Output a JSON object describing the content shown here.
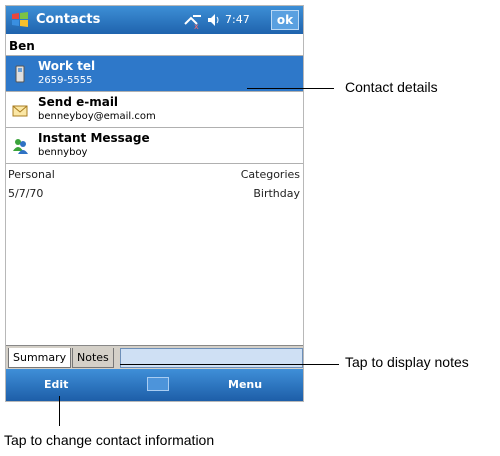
{
  "device": {
    "title": "Contacts",
    "time": "7:47",
    "ok_label": "ok",
    "icons": {
      "start": "windows-flag-icon",
      "connectivity": "connectivity-icon",
      "volume": "speaker-icon"
    }
  },
  "contact": {
    "name": "Ben",
    "items": [
      {
        "label": "Work tel",
        "value": "2659-5555",
        "icon": "phone-icon",
        "selected": true
      },
      {
        "label": "Send e-mail",
        "value": "benneyboy@email.com",
        "icon": "envelope-icon",
        "selected": false
      },
      {
        "label": "Instant Message",
        "value": "bennyboy",
        "icon": "messenger-icon",
        "selected": false
      }
    ],
    "category_left": "Personal",
    "category_right": "Categories",
    "birthday_value": "5/7/70",
    "birthday_label": "Birthday"
  },
  "tabs": {
    "summary": "Summary",
    "notes": "Notes"
  },
  "menubar": {
    "left": "Edit",
    "right": "Menu",
    "center_icon": "keyboard-icon"
  },
  "callouts": {
    "contact_details": "Contact details",
    "tap_notes": "Tap to display notes",
    "tap_change": "Tap to change contact information"
  },
  "colors": {
    "titlebar": "#2a74c2",
    "selected_row": "#2e78c9",
    "tabs_bg": "#d4d0c8"
  }
}
